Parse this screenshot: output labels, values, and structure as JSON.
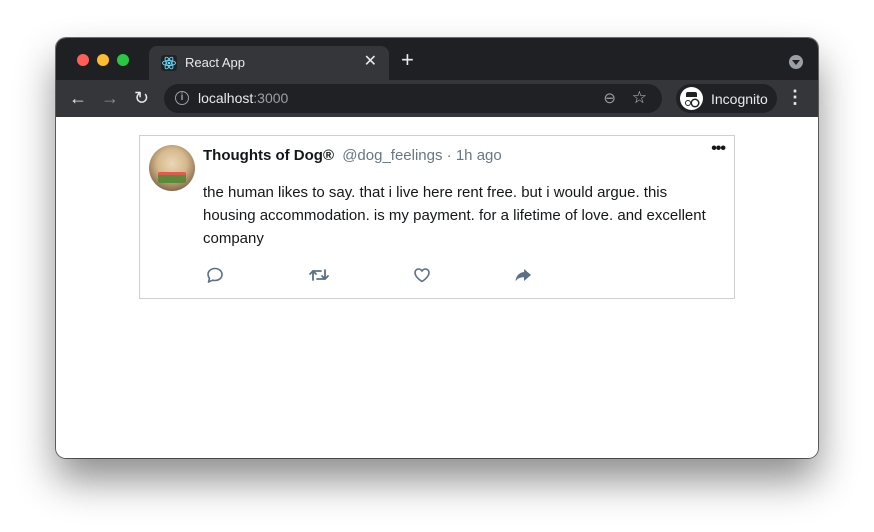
{
  "browser": {
    "tab": {
      "title": "React App",
      "favicon": "react-logo-icon",
      "close_glyph": "✕"
    },
    "new_tab_glyph": "+",
    "toolbar": {
      "back_glyph": "←",
      "forward_glyph": "→",
      "reload_glyph": "↻",
      "url_host": "localhost",
      "url_port": ":3000",
      "zoom_glyph": "⊖",
      "star_glyph": "☆",
      "profile_label": "Incognito",
      "menu_glyph": "⋮"
    }
  },
  "tweet": {
    "name": "Thoughts of Dog®",
    "handle": "@dog_feelings",
    "separator": "·",
    "time": "1h ago",
    "more_glyph": "•••",
    "text": "the human likes to say. that i live here rent free. but i would argue. this housing accommodation. is my payment. for a lifetime of love. and excellent company",
    "actions": [
      "reply",
      "retweet",
      "like",
      "share"
    ],
    "icon_color": "#5b7083"
  }
}
